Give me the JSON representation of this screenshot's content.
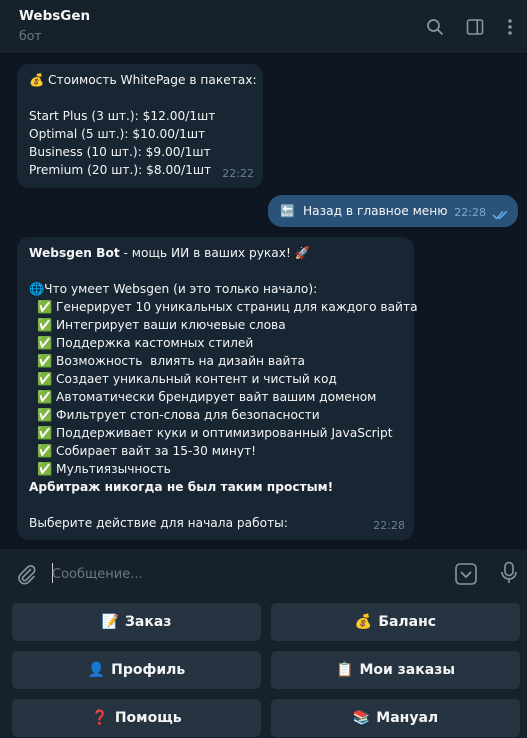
{
  "header": {
    "title": "WebsGen",
    "subtitle": "бот"
  },
  "messages": {
    "pricing": {
      "lines": [
        "💰 Стоимость WhitePage в пакетах:",
        "",
        "Start Plus (3 шт.): $12.00/1шт",
        "Optimal (5 шт.): $10.00/1шт",
        "Business (10 шт.): $9.00/1шт",
        "Premium (20 шт.): $8.00/1шт"
      ],
      "time": "22:22"
    },
    "back": {
      "icon": "🔙",
      "text": "Назад в главное меню",
      "time": "22:28",
      "status": "read"
    },
    "welcome": {
      "bot_name": "Websgen Bot",
      "intro": " - мощь ИИ в ваших руках! 🚀",
      "features_heading": "🌐Что умеет Websgen (и это только начало):",
      "features": [
        "✅ Генерирует 10 уникальных страниц для каждого вайта",
        "✅ Интегрирует ваши ключевые слова",
        "✅ Поддержка кастомных стилей",
        "✅ Возможность  влиять на дизайн вайта",
        "✅ Создает уникальный контент и чистый код",
        "✅ Автоматически брендирует вайт вашим доменом",
        "✅ Фильтрует стоп-слова для безопасности",
        "✅ Поддерживает куки и оптимизированный JavaScript",
        "✅ Собирает вайт за 15-30 минут!",
        "✅ Мультиязычность"
      ],
      "tagline": "Арбитраж никогда не был таким простым!",
      "prompt": "Выберите действие для начала работы:",
      "time": "22:28"
    }
  },
  "composer": {
    "placeholder": "Сообщение..."
  },
  "keyboard": {
    "buttons": [
      {
        "emoji": "📝",
        "label": "Заказ"
      },
      {
        "emoji": "💰",
        "label": "Баланс"
      },
      {
        "emoji": "👤",
        "label": "Профиль"
      },
      {
        "emoji": "📋",
        "label": "Мои заказы"
      },
      {
        "emoji": "❓",
        "label": "Помощь"
      },
      {
        "emoji": "📚",
        "label": "Мануал"
      }
    ]
  },
  "colors": {
    "background": "#0e1621",
    "header": "#17212b",
    "incoming_bubble": "#182533",
    "outgoing_bubble": "#2b5278",
    "keyboard_button": "#263340",
    "muted_text": "#6c7883",
    "read_check": "#5eb5f7"
  },
  "icons": [
    "search-icon",
    "sidebar-toggle-icon",
    "more-vertical-icon",
    "paperclip-icon",
    "keyboard-toggle-icon",
    "microphone-icon",
    "double-check-icon"
  ]
}
